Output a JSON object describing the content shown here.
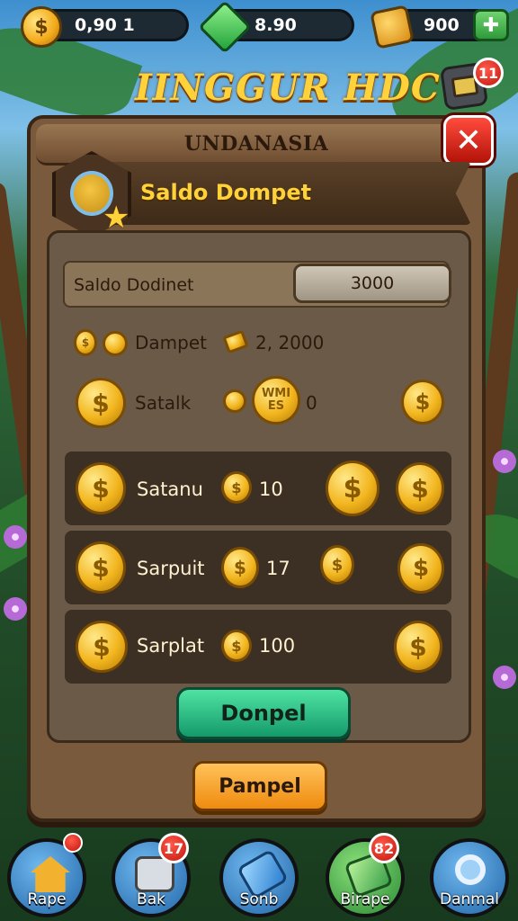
{
  "topbar": {
    "coins": "0,90 1",
    "gems": "8.90",
    "chests": "900",
    "add_label": "✚"
  },
  "game_title": "IINGGUR HDC",
  "mail_badge": "11",
  "panel": {
    "header": "UNDANASIA",
    "close_label": "✕",
    "banner_title": "Saldo Dompet",
    "balance_label": "Saldo Dodinet",
    "balance_value": "3000",
    "dompet_label": "Dampet",
    "dompet_value": "2, 2000",
    "satalk_label": "Satalk",
    "satalk_badge": "WMI\nES",
    "satalk_value": "0",
    "rows": [
      {
        "label": "Satanu",
        "value": "10"
      },
      {
        "label": "Sarpuit",
        "value": "17"
      },
      {
        "label": "Sarplat",
        "value": "100"
      }
    ],
    "green_button": "Donpel",
    "orange_button": "Pampel"
  },
  "nav": [
    {
      "label": "Rape",
      "badge": "",
      "color": "#3b8fd4"
    },
    {
      "label": "Bak",
      "badge": "17",
      "color": "#3b8fd4"
    },
    {
      "label": "Sonb",
      "badge": "",
      "color": "#3b8fd4"
    },
    {
      "label": "Birape",
      "badge": "82",
      "color": "#2fb34a"
    },
    {
      "label": "Danmal",
      "badge": "",
      "color": "#3b8fd4"
    }
  ]
}
